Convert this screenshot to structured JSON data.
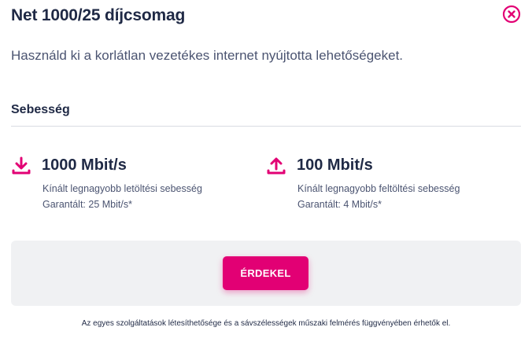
{
  "dialog": {
    "title": "Net 1000/25 díjcsomag",
    "subtitle": "Használd ki a korlátlan vezetékes internet nyújtotta lehetőségeket.",
    "close_icon": "close-circle-icon"
  },
  "speed_section": {
    "title": "Sebesség",
    "download": {
      "icon": "download-icon",
      "value": "1000 Mbit/s",
      "description": "Kínált legnagyobb letöltési sebesség",
      "guaranteed": "Garantált: 25 Mbit/s*"
    },
    "upload": {
      "icon": "upload-icon",
      "value": "100 Mbit/s",
      "description": "Kínált legnagyobb feltöltési sebesség",
      "guaranteed": "Garantált: 4 Mbit/s*"
    }
  },
  "action": {
    "cta_label": "ÉRDEKEL"
  },
  "footnote": "Az egyes szolgáltatások létesíthetősége és a sávszélességek műszaki felmérés függvényében érhetők el.",
  "colors": {
    "accent": "#e20074",
    "text_dark": "#1f2945",
    "text_muted": "#4b5471",
    "panel_bg": "#f0f1f3"
  }
}
